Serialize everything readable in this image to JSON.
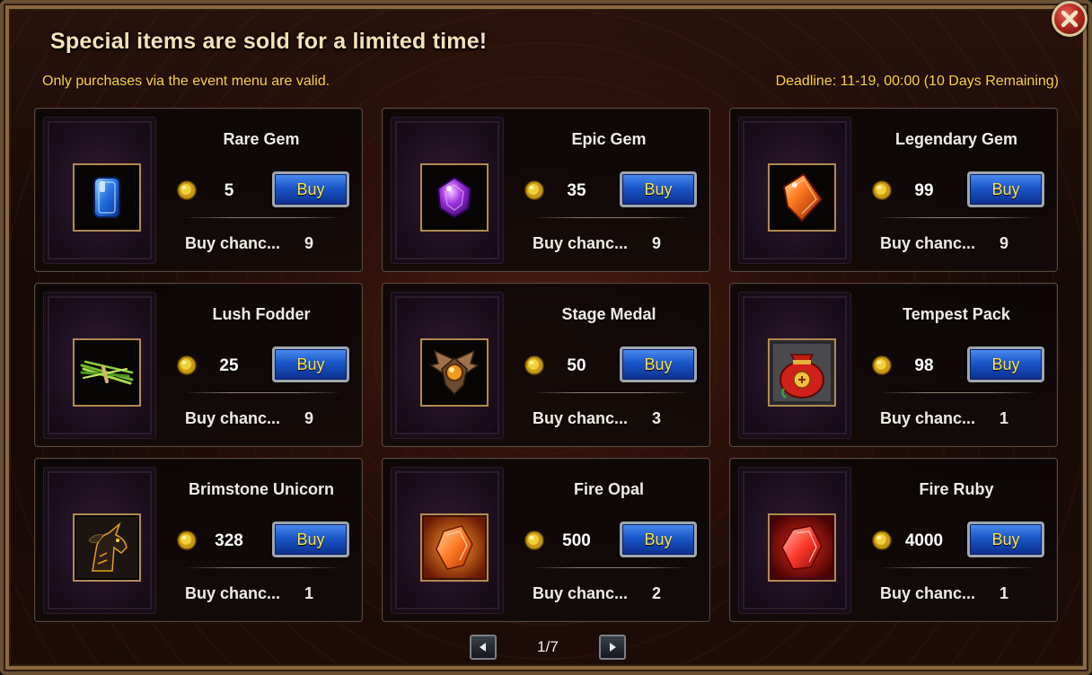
{
  "header": {
    "title": "Special items are sold for a limited time!",
    "subtitle": "Only purchases via the event menu are valid.",
    "deadline": "Deadline: 11-19, 00:00 (10 Days Remaining)"
  },
  "buy_label": "Buy",
  "chance_label": "Buy chanc...",
  "items": [
    {
      "name": "Rare Gem",
      "price": "5",
      "chances": "9",
      "icon": "blue-gem-icon"
    },
    {
      "name": "Epic Gem",
      "price": "35",
      "chances": "9",
      "icon": "purple-gem-icon"
    },
    {
      "name": "Legendary Gem",
      "price": "99",
      "chances": "9",
      "icon": "orange-gem-icon"
    },
    {
      "name": "Lush Fodder",
      "price": "25",
      "chances": "9",
      "icon": "grass-fodder-icon"
    },
    {
      "name": "Stage Medal",
      "price": "50",
      "chances": "3",
      "icon": "winged-medal-icon"
    },
    {
      "name": "Tempest Pack",
      "price": "98",
      "chances": "1",
      "icon": "red-pouch-icon"
    },
    {
      "name": "Brimstone Unicorn",
      "price": "328",
      "chances": "1",
      "icon": "dark-unicorn-icon"
    },
    {
      "name": "Fire Opal",
      "price": "500",
      "chances": "2",
      "icon": "fire-opal-icon"
    },
    {
      "name": "Fire Ruby",
      "price": "4000",
      "chances": "1",
      "icon": "fire-ruby-icon"
    }
  ],
  "pagination": {
    "page": "1/7"
  },
  "colors": {
    "accent_text": "#ffd23f",
    "button": "#1a56c8",
    "button_text": "#ffe14a"
  }
}
